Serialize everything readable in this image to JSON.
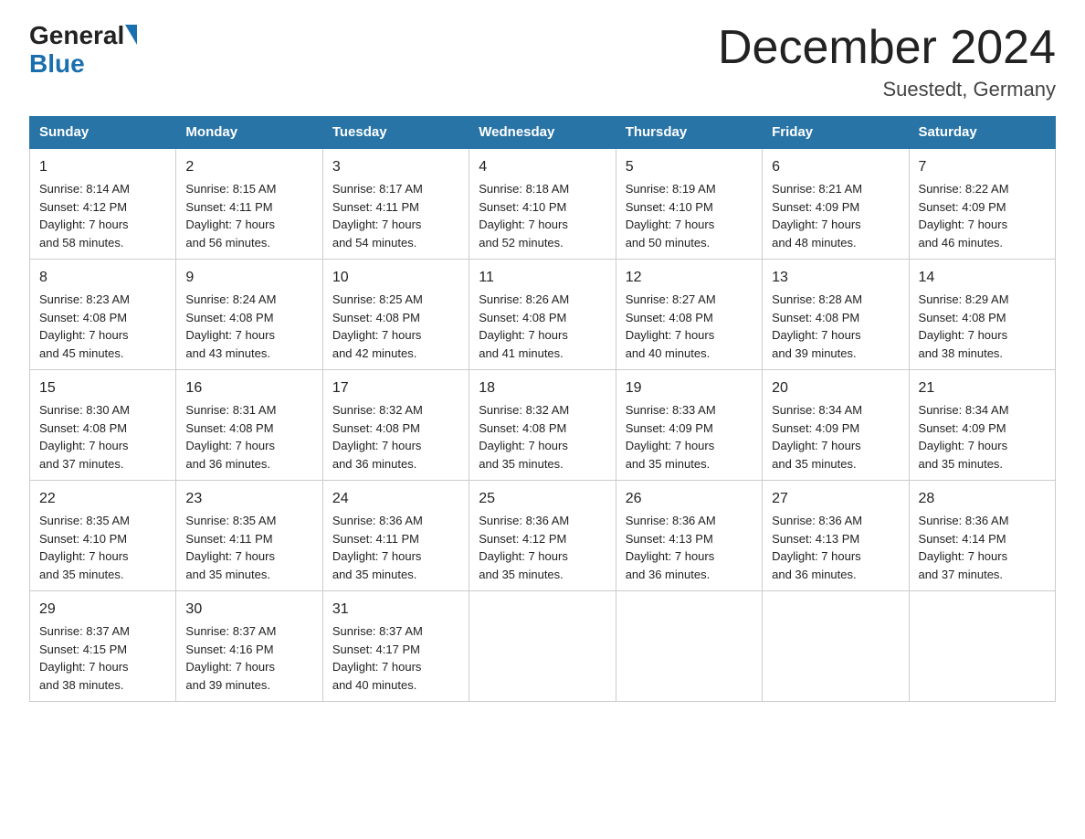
{
  "header": {
    "logo_general": "General",
    "logo_blue": "Blue",
    "title": "December 2024",
    "subtitle": "Suestedt, Germany"
  },
  "days_of_week": [
    "Sunday",
    "Monday",
    "Tuesday",
    "Wednesday",
    "Thursday",
    "Friday",
    "Saturday"
  ],
  "weeks": [
    [
      {
        "day": "1",
        "sunrise": "8:14 AM",
        "sunset": "4:12 PM",
        "daylight": "7 hours and 58 minutes."
      },
      {
        "day": "2",
        "sunrise": "8:15 AM",
        "sunset": "4:11 PM",
        "daylight": "7 hours and 56 minutes."
      },
      {
        "day": "3",
        "sunrise": "8:17 AM",
        "sunset": "4:11 PM",
        "daylight": "7 hours and 54 minutes."
      },
      {
        "day": "4",
        "sunrise": "8:18 AM",
        "sunset": "4:10 PM",
        "daylight": "7 hours and 52 minutes."
      },
      {
        "day": "5",
        "sunrise": "8:19 AM",
        "sunset": "4:10 PM",
        "daylight": "7 hours and 50 minutes."
      },
      {
        "day": "6",
        "sunrise": "8:21 AM",
        "sunset": "4:09 PM",
        "daylight": "7 hours and 48 minutes."
      },
      {
        "day": "7",
        "sunrise": "8:22 AM",
        "sunset": "4:09 PM",
        "daylight": "7 hours and 46 minutes."
      }
    ],
    [
      {
        "day": "8",
        "sunrise": "8:23 AM",
        "sunset": "4:08 PM",
        "daylight": "7 hours and 45 minutes."
      },
      {
        "day": "9",
        "sunrise": "8:24 AM",
        "sunset": "4:08 PM",
        "daylight": "7 hours and 43 minutes."
      },
      {
        "day": "10",
        "sunrise": "8:25 AM",
        "sunset": "4:08 PM",
        "daylight": "7 hours and 42 minutes."
      },
      {
        "day": "11",
        "sunrise": "8:26 AM",
        "sunset": "4:08 PM",
        "daylight": "7 hours and 41 minutes."
      },
      {
        "day": "12",
        "sunrise": "8:27 AM",
        "sunset": "4:08 PM",
        "daylight": "7 hours and 40 minutes."
      },
      {
        "day": "13",
        "sunrise": "8:28 AM",
        "sunset": "4:08 PM",
        "daylight": "7 hours and 39 minutes."
      },
      {
        "day": "14",
        "sunrise": "8:29 AM",
        "sunset": "4:08 PM",
        "daylight": "7 hours and 38 minutes."
      }
    ],
    [
      {
        "day": "15",
        "sunrise": "8:30 AM",
        "sunset": "4:08 PM",
        "daylight": "7 hours and 37 minutes."
      },
      {
        "day": "16",
        "sunrise": "8:31 AM",
        "sunset": "4:08 PM",
        "daylight": "7 hours and 36 minutes."
      },
      {
        "day": "17",
        "sunrise": "8:32 AM",
        "sunset": "4:08 PM",
        "daylight": "7 hours and 36 minutes."
      },
      {
        "day": "18",
        "sunrise": "8:32 AM",
        "sunset": "4:08 PM",
        "daylight": "7 hours and 35 minutes."
      },
      {
        "day": "19",
        "sunrise": "8:33 AM",
        "sunset": "4:09 PM",
        "daylight": "7 hours and 35 minutes."
      },
      {
        "day": "20",
        "sunrise": "8:34 AM",
        "sunset": "4:09 PM",
        "daylight": "7 hours and 35 minutes."
      },
      {
        "day": "21",
        "sunrise": "8:34 AM",
        "sunset": "4:09 PM",
        "daylight": "7 hours and 35 minutes."
      }
    ],
    [
      {
        "day": "22",
        "sunrise": "8:35 AM",
        "sunset": "4:10 PM",
        "daylight": "7 hours and 35 minutes."
      },
      {
        "day": "23",
        "sunrise": "8:35 AM",
        "sunset": "4:11 PM",
        "daylight": "7 hours and 35 minutes."
      },
      {
        "day": "24",
        "sunrise": "8:36 AM",
        "sunset": "4:11 PM",
        "daylight": "7 hours and 35 minutes."
      },
      {
        "day": "25",
        "sunrise": "8:36 AM",
        "sunset": "4:12 PM",
        "daylight": "7 hours and 35 minutes."
      },
      {
        "day": "26",
        "sunrise": "8:36 AM",
        "sunset": "4:13 PM",
        "daylight": "7 hours and 36 minutes."
      },
      {
        "day": "27",
        "sunrise": "8:36 AM",
        "sunset": "4:13 PM",
        "daylight": "7 hours and 36 minutes."
      },
      {
        "day": "28",
        "sunrise": "8:36 AM",
        "sunset": "4:14 PM",
        "daylight": "7 hours and 37 minutes."
      }
    ],
    [
      {
        "day": "29",
        "sunrise": "8:37 AM",
        "sunset": "4:15 PM",
        "daylight": "7 hours and 38 minutes."
      },
      {
        "day": "30",
        "sunrise": "8:37 AM",
        "sunset": "4:16 PM",
        "daylight": "7 hours and 39 minutes."
      },
      {
        "day": "31",
        "sunrise": "8:37 AM",
        "sunset": "4:17 PM",
        "daylight": "7 hours and 40 minutes."
      },
      null,
      null,
      null,
      null
    ]
  ],
  "labels": {
    "sunrise_prefix": "Sunrise: ",
    "sunset_prefix": "Sunset: ",
    "daylight_prefix": "Daylight: "
  }
}
